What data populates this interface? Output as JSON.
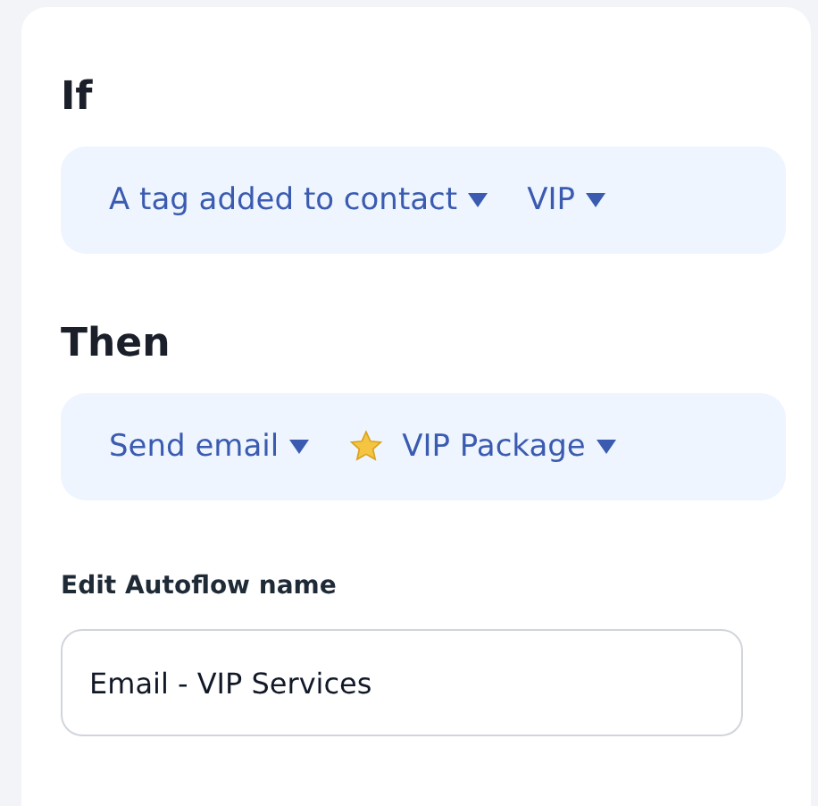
{
  "rules": [
    {
      "heading": "If",
      "dropdowns": [
        {
          "kind": "plain",
          "label": "A tag added to contact"
        },
        {
          "kind": "plain",
          "label": "VIP"
        }
      ]
    },
    {
      "heading": "Then",
      "dropdowns": [
        {
          "kind": "plain",
          "label": "Send email"
        },
        {
          "kind": "starred",
          "label": "VIP Package"
        }
      ]
    }
  ],
  "name_field": {
    "label": "Edit Autoflow name",
    "value": "Email - VIP Services"
  }
}
